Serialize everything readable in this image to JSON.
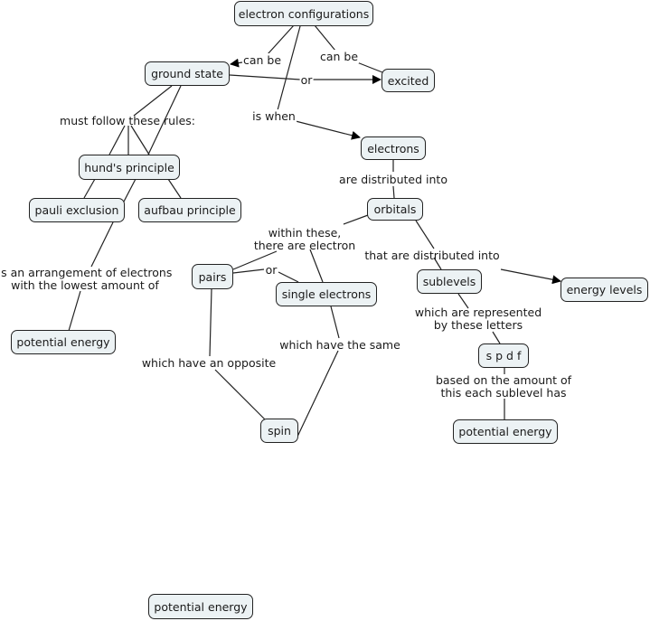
{
  "concept_map": {
    "nodes": {
      "electron_configurations": "electron configurations",
      "ground_state": "ground state",
      "excited": "excited",
      "hunds_principle": "hund's principle",
      "pauli_exclusion": "pauli exclusion",
      "aufbau_principle": "aufbau principle",
      "potential_energy_left": "potential energy",
      "electrons": "electrons",
      "orbitals": "orbitals",
      "pairs": "pairs",
      "single_electrons": "single electrons",
      "spin": "spin",
      "sublevels": "sublevels",
      "energy_levels": "energy levels",
      "spdf": "s p d f",
      "potential_energy_right": "potential energy",
      "potential_energy_orphan": "potential energy"
    },
    "link_labels": {
      "can_be_left": "can be",
      "can_be_right": "can be",
      "or_top": "or",
      "is_when": "is when",
      "must_follow": "must follow these rules:",
      "arrangement_1": "is an arrangement of electrons",
      "arrangement_2": "with the lowest amount of",
      "are_distributed_into": "are distributed into",
      "within_1": "within these,",
      "within_2": "there are electron",
      "or_pairs": "or",
      "that_are_distributed": "that are distributed into",
      "which_opposite": "which have an opposite",
      "which_same": "which have the same",
      "represented_1": "which are represented",
      "represented_2": "by these letters",
      "based_1": "based on the amount of",
      "based_2": "this each sublevel has"
    }
  }
}
